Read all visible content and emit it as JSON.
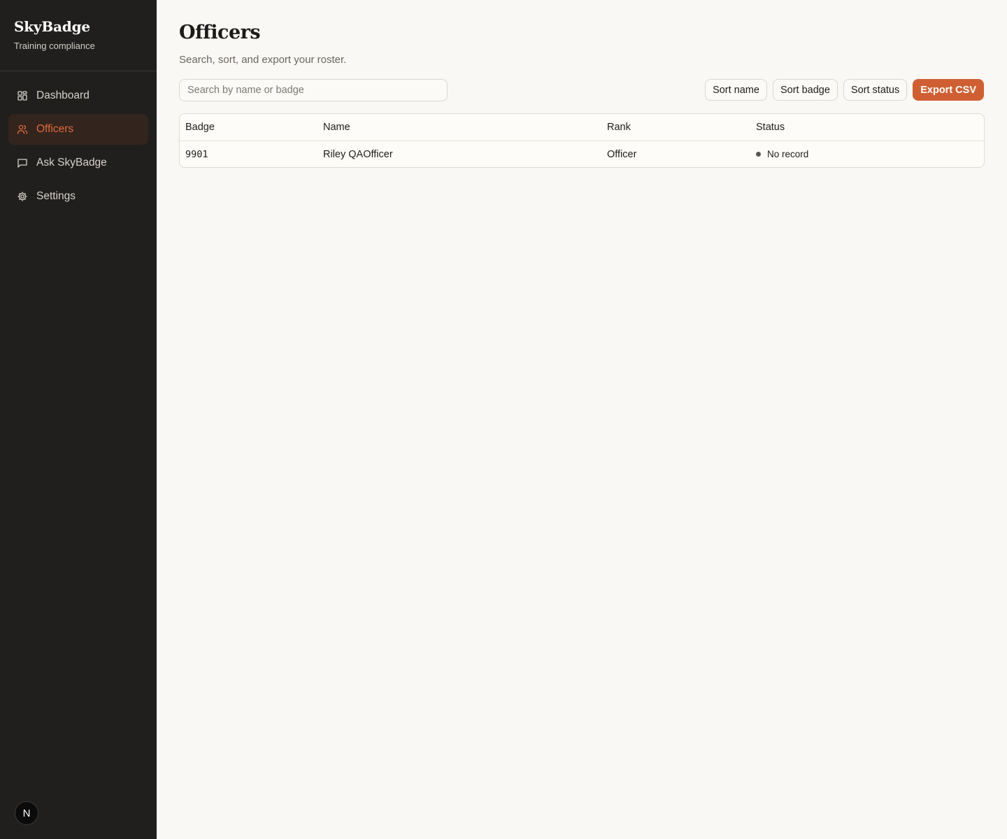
{
  "brand": {
    "name": "SkyBadge",
    "subtitle": "Training compliance"
  },
  "sidebar": {
    "items": [
      {
        "label": "Dashboard",
        "icon": "dashboard-icon",
        "active": false
      },
      {
        "label": "Officers",
        "icon": "users-icon",
        "active": true
      },
      {
        "label": "Ask SkyBadge",
        "icon": "chat-icon",
        "active": false
      },
      {
        "label": "Settings",
        "icon": "gear-icon",
        "active": false
      }
    ],
    "avatar_letter": "N"
  },
  "page": {
    "title": "Officers",
    "subtitle": "Search, sort, and export your roster."
  },
  "toolbar": {
    "search_placeholder": "Search by name or badge",
    "search_value": "",
    "sort_name_label": "Sort name",
    "sort_badge_label": "Sort badge",
    "sort_status_label": "Sort status",
    "export_label": "Export CSV"
  },
  "table": {
    "columns": [
      "Badge",
      "Name",
      "Rank",
      "Status"
    ],
    "rows": [
      {
        "badge": "9901",
        "name": "Riley QAOfficer",
        "rank": "Officer",
        "status": "No record"
      }
    ]
  },
  "colors": {
    "accent": "#cf5f33",
    "sidebar_bg": "#201f1d",
    "active_nav_text": "#e06a3b",
    "status_dot": "#5a5754"
  }
}
